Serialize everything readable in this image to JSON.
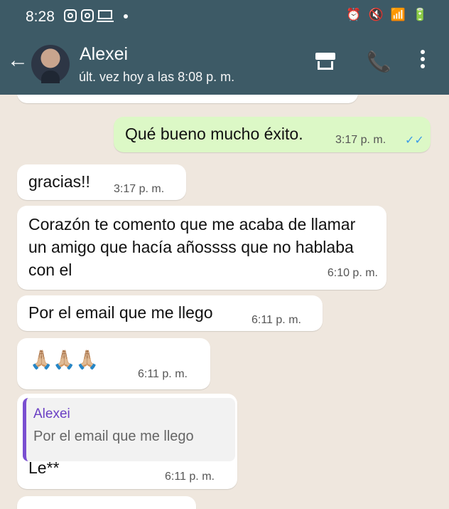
{
  "status_bar": {
    "time": "8:28"
  },
  "header": {
    "contact_name": "Alexei",
    "last_seen": "últ. vez hoy a las 8:08 p. m."
  },
  "messages": [
    {
      "direction": "out",
      "text": "Qué bueno mucho éxito.",
      "time": "3:17 p. m.",
      "read": true
    },
    {
      "direction": "in",
      "text": "gracias!!",
      "time": "3:17 p. m."
    },
    {
      "direction": "in",
      "text": "Corazón te comento que me acaba de llamar un amigo que hacía añossss que no hablaba con el",
      "time": "6:10 p. m."
    },
    {
      "direction": "in",
      "text": "Por el email que me llego",
      "time": "6:11 p. m."
    },
    {
      "direction": "in",
      "text": "🙏🏼🙏🏼🙏🏼",
      "time": "6:11 p. m."
    },
    {
      "direction": "in",
      "reply_to_name": "Alexei",
      "reply_to_text": "Por el email que me llego",
      "text": "Le**",
      "time": "6:11 p. m."
    }
  ],
  "colors": {
    "header": "#3d5a66",
    "chat_bg": "#efe7de",
    "outgoing": "#dcf8c6",
    "incoming": "#ffffff",
    "tick": "#3b9be8"
  },
  "icons": [
    "back-arrow-icon",
    "store-icon",
    "add-call-icon",
    "more-vert-icon"
  ]
}
